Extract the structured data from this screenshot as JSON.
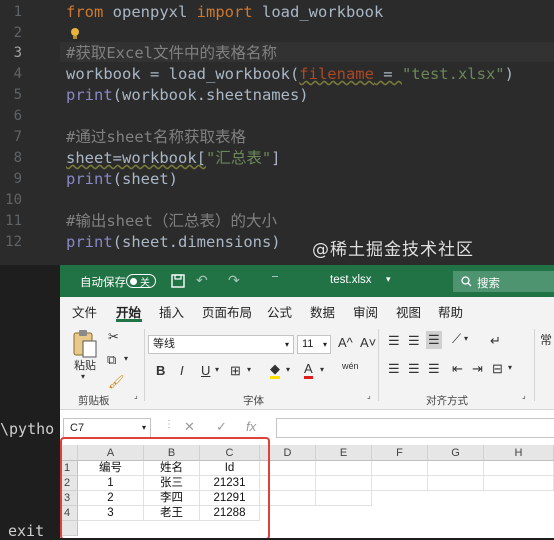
{
  "editor": {
    "line_numbers": [
      "1",
      "2",
      "3",
      "4",
      "5",
      "6",
      "7",
      "8",
      "9",
      "10",
      "11",
      "12"
    ],
    "line1": {
      "kw1": "from",
      "mod": " openpyxl ",
      "kw2": "import",
      "rest": " load_workbook"
    },
    "line3_comment": "#获取Excel文件中的表格名称",
    "line4": {
      "a": "workbook = load_workbook(",
      "param": "filename",
      "b": " = ",
      "str": "\"test.xlsx\"",
      "c": ")"
    },
    "line5": {
      "fn": "print",
      "rest": "(workbook.sheetnames)"
    },
    "line7_comment": "#通过sheet名称获取表格",
    "line8": {
      "a": "sheet=workbook[",
      "str": "\"汇总表\"",
      "b": "]"
    },
    "line9": {
      "fn": "print",
      "rest": "(sheet)"
    },
    "line11_comment": "#输出sheet（汇总表）的大小",
    "line12": {
      "fn": "print",
      "rest": "(sheet.dimensions)"
    }
  },
  "terminal": {
    "line1": "\\pytho",
    "line2": "exit"
  },
  "excel": {
    "autosave_label": "自动保存",
    "autosave_state": "关",
    "file_name": "test.xlsx",
    "search_label": "搜索",
    "menu": [
      "文件",
      "开始",
      "插入",
      "页面布局",
      "公式",
      "数据",
      "审阅",
      "视图",
      "帮助"
    ],
    "active_menu": "开始",
    "clipboard": {
      "paste_label": "粘贴",
      "group_label": "剪贴板"
    },
    "font": {
      "name": "等线",
      "size": "11",
      "group_label": "字体",
      "grow": "A^",
      "shrink": "A˅",
      "bold": "B",
      "italic": "I",
      "underline": "U",
      "fontcolor": "A",
      "wen": "wén"
    },
    "alignment": {
      "group_label": "对齐方式"
    },
    "styles_label": "常",
    "name_box": "C7",
    "columns": [
      "A",
      "B",
      "C",
      "D",
      "E",
      "F",
      "G",
      "H"
    ],
    "rows": [
      "1",
      "2",
      "3",
      "4"
    ],
    "table": [
      [
        "编号",
        "姓名",
        "Id"
      ],
      [
        "1",
        "张三",
        "21231"
      ],
      [
        "2",
        "李四",
        "21291"
      ],
      [
        "3",
        "老王",
        "21288"
      ]
    ]
  },
  "watermark": "@稀土掘金技术社区",
  "colors": {
    "excel_green": "#217346",
    "editor_bg": "#2b2b2b",
    "highlight": "#e0403a"
  }
}
